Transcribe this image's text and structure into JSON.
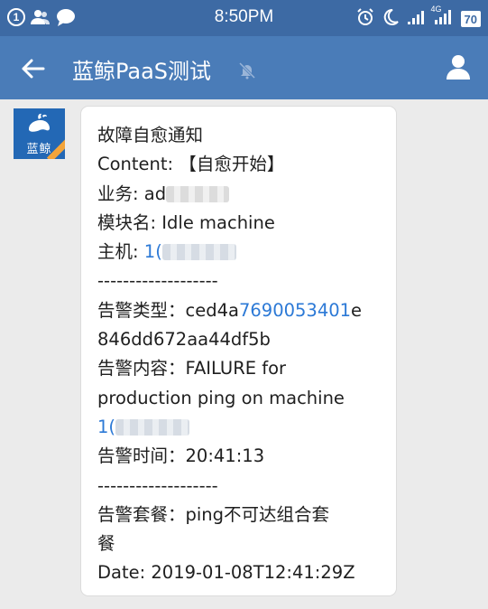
{
  "status_bar": {
    "notification_count": "1",
    "time": "8:50PM",
    "network_label": "4G",
    "battery": "70"
  },
  "app_bar": {
    "title": "蓝鲸PaaS测试"
  },
  "avatar": {
    "label": "蓝鲸"
  },
  "message": {
    "title": "故障自愈通知",
    "content_label": "Content: ",
    "content_value": "【自愈开始】",
    "business_label": "业务: ",
    "business_value": "ad",
    "module_label": "模块名: ",
    "module_value": "Idle machine",
    "host_label": "主机: ",
    "host_value": "1(",
    "separator": "-------------------",
    "alarm_type_label": "告警类型：",
    "alarm_type_a": "ced4a",
    "alarm_type_link": "7690053401",
    "alarm_type_b": "e",
    "alarm_type_line2": "846dd672aa44df5b",
    "alarm_content_label": "告警内容：",
    "alarm_content_a": "FAILURE for",
    "alarm_content_b": "production ping on machine",
    "alarm_content_ip": "1(",
    "alarm_time_label": "告警时间：",
    "alarm_time_value": "20:41:13",
    "separator2": "-------------------",
    "alarm_package_label": "告警套餐：",
    "alarm_package_value": "ping不可达组合套",
    "alarm_package_cont": "餐",
    "date_line": "Date: 2019-01-08T12:41:29Z"
  },
  "colors": {
    "status_bar": "#3d6aa4",
    "app_bar": "#4a7cb8",
    "background": "#ebebeb",
    "link": "#2c79d6",
    "avatar": "#2368b5"
  },
  "icons": [
    "notification-badge-icon",
    "contacts-icon",
    "chat-icon",
    "alarm-icon",
    "moon-icon",
    "wifi-icon",
    "signal-icon",
    "battery-icon",
    "back-arrow-icon",
    "mute-bell-icon",
    "profile-icon",
    "whale-icon"
  ]
}
